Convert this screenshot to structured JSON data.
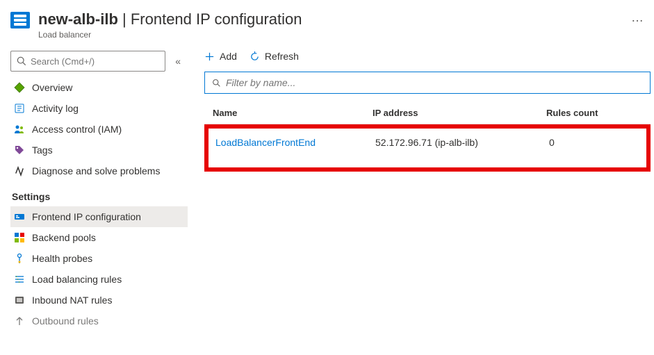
{
  "header": {
    "resource_name": "new-alb-ilb",
    "breadcrumb_separator": " | ",
    "page_title": "Frontend IP configuration",
    "subtitle": "Load balancer",
    "more": "…"
  },
  "sidebar": {
    "search_placeholder": "Search (Cmd+/)",
    "collapse": "«",
    "items_top": [
      {
        "label": "Overview"
      },
      {
        "label": "Activity log"
      },
      {
        "label": "Access control (IAM)"
      },
      {
        "label": "Tags"
      },
      {
        "label": "Diagnose and solve problems"
      }
    ],
    "section_settings": "Settings",
    "items_settings": [
      {
        "label": "Frontend IP configuration"
      },
      {
        "label": "Backend pools"
      },
      {
        "label": "Health probes"
      },
      {
        "label": "Load balancing rules"
      },
      {
        "label": "Inbound NAT rules"
      },
      {
        "label": "Outbound rules"
      }
    ]
  },
  "toolbar": {
    "add_label": "Add",
    "refresh_label": "Refresh"
  },
  "filter": {
    "placeholder": "Filter by name..."
  },
  "table": {
    "headers": {
      "name": "Name",
      "ip": "IP address",
      "rules": "Rules count"
    },
    "row": {
      "name": "LoadBalancerFrontEnd",
      "ip": "52.172.96.71 (ip-alb-ilb)",
      "rules": "0"
    }
  }
}
